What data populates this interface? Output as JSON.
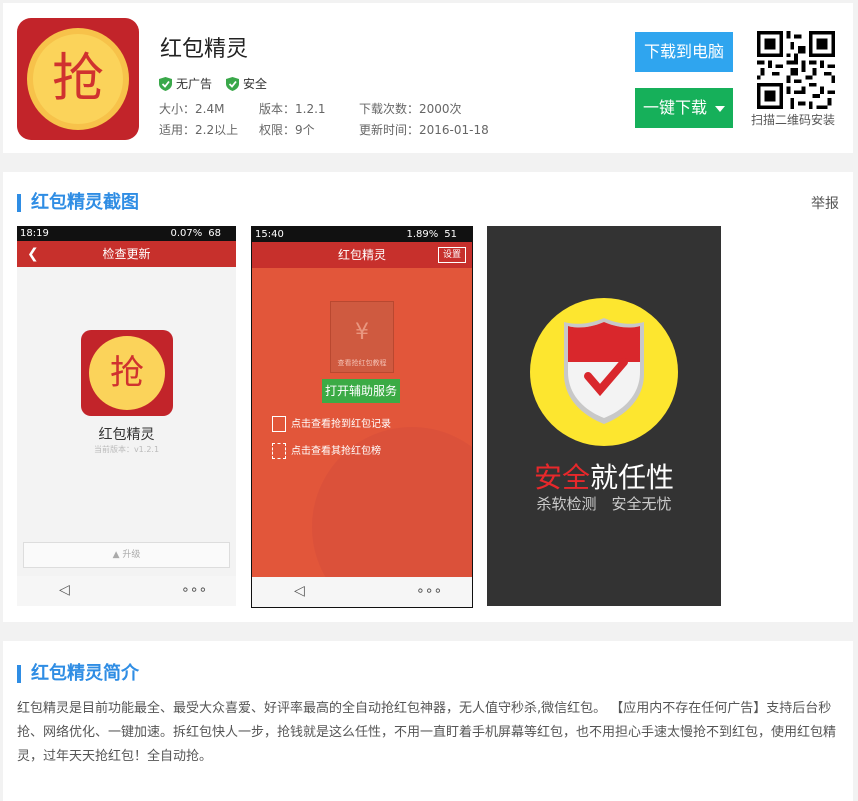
{
  "app": {
    "name": "红包精灵",
    "icon_glyph": "抢",
    "badges": [
      "无广告",
      "安全"
    ],
    "meta": {
      "size": "大小：2.4M",
      "version": "版本：1.2.1",
      "downloads": "下载次数：2000次",
      "compat": "适用：2.2以上",
      "permissions": "权限：9个",
      "updated": "更新时间：2016-01-18"
    }
  },
  "actions": {
    "download_pc": "下载到电脑",
    "one_click": "一键下载",
    "qr_caption": "扫描二维码安装"
  },
  "colors": {
    "blue": "#2fa5ef",
    "green": "#16b05a",
    "red": "#c2242a",
    "accent": "#2f8de4"
  },
  "screens_section": {
    "title": "红包精灵截图",
    "report": "举报",
    "shot1": {
      "time": "18:19",
      "status_right": "0.07%",
      "battery": "68",
      "toolbar_title": "检查更新",
      "app_name": "红包精灵",
      "version_line": "当前版本：v1.2.1",
      "upgrade": "升级",
      "nav_back": "◁",
      "nav_more": "∘∘∘"
    },
    "shot2": {
      "time": "15:40",
      "status_right": "1.89%",
      "battery": "51",
      "toolbar_title": "红包精灵",
      "settings": "设置",
      "envelope_caption": "查看抢红包教程",
      "envelope_symbol": "¥",
      "open_service": "打开辅助服务",
      "record_link": "点击查看抢到红包记录",
      "rank_link": "点击查看其抢红包榜",
      "nav_back": "◁",
      "nav_more": "∘∘∘"
    },
    "shot3": {
      "slogan_red": "安全",
      "slogan_white": "就任性",
      "subline": "杀软检测　安全无忧"
    }
  },
  "intro": {
    "title": "红包精灵简介",
    "text": "红包精灵是目前功能最全、最受大众喜爱、好评率最高的全自动抢红包神器，无人值守秒杀,微信红包。 【应用内不存在任何广告】支持后台秒抢、网络优化、一键加速。拆红包快人一步，抢钱就是这么任性，不用一直盯着手机屏幕等红包，也不用担心手速太慢抢不到红包，使用红包精灵，过年天天抢红包！全自动抢。"
  }
}
